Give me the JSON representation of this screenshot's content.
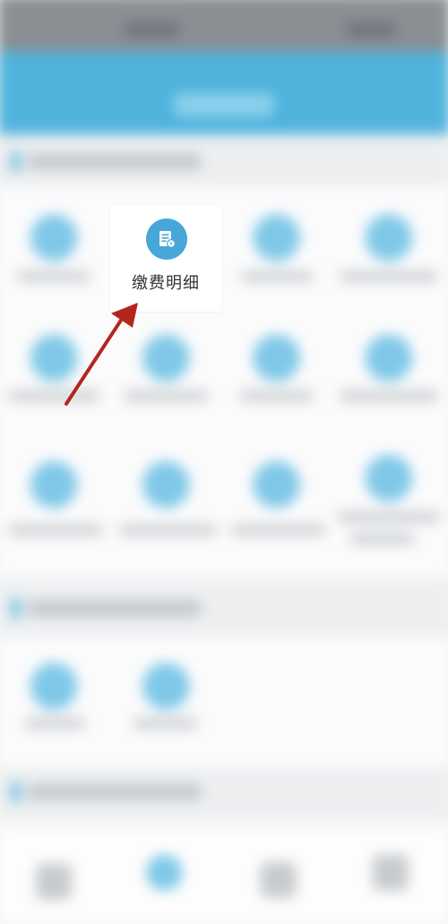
{
  "focused_item": {
    "label": "缴费明细",
    "icon": "bill-details-icon",
    "accent_color": "#47a7d8"
  },
  "annotation": {
    "type": "arrow",
    "color": "#b3261e"
  },
  "theme": {
    "header_color": "#4fb3dc",
    "icon_color": "#7fc8e8"
  }
}
